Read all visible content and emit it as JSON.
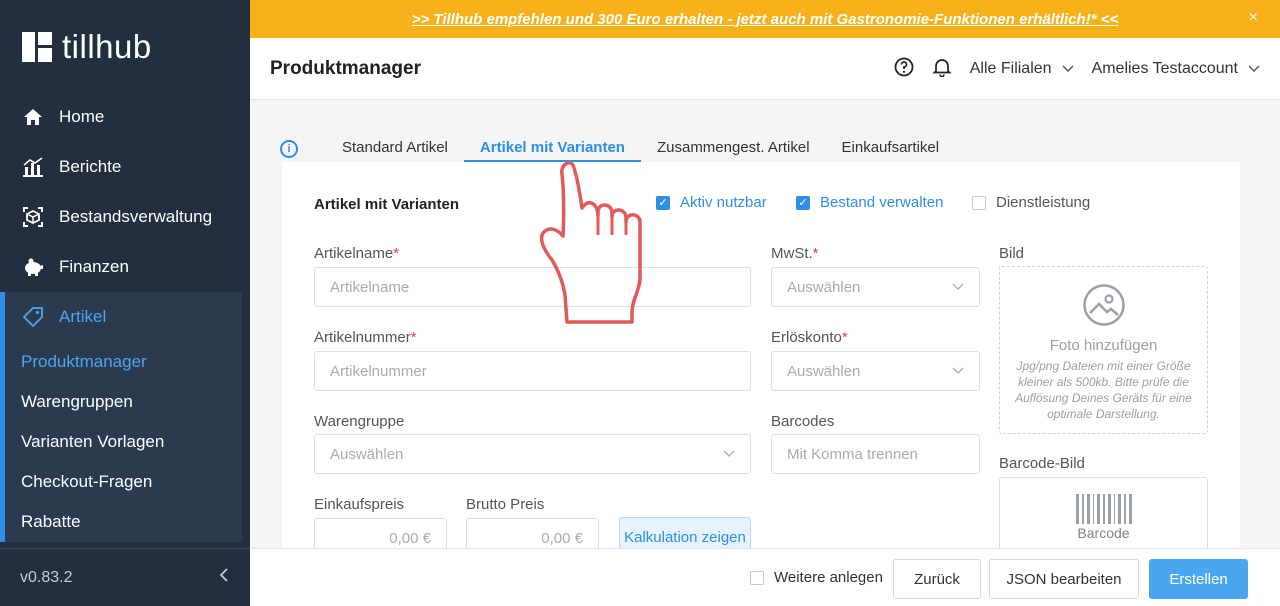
{
  "banner": {
    "text": ">> Tillhub empfehlen und 300 Euro erhalten - jetzt auch mit Gastronomie-Funktionen erhältlich!* <<",
    "close": "×"
  },
  "sidebar": {
    "logo": "tillhub",
    "items": [
      {
        "label": "Home",
        "icon": "home-icon"
      },
      {
        "label": "Berichte",
        "icon": "chart-icon"
      },
      {
        "label": "Bestandsverwaltung",
        "icon": "inventory-icon"
      },
      {
        "label": "Finanzen",
        "icon": "piggy-bank-icon"
      },
      {
        "label": "Artikel",
        "icon": "tag-icon"
      }
    ],
    "subitems": [
      "Produktmanager",
      "Warengruppen",
      "Varianten Vorlagen",
      "Checkout-Fragen",
      "Rabatte"
    ],
    "version": "v0.83.2"
  },
  "header": {
    "title": "Produktmanager",
    "branch": "Alle Filialen",
    "account": "Amelies Testaccount"
  },
  "tabs": [
    "Standard Artikel",
    "Artikel mit Varianten",
    "Zusammengest. Artikel",
    "Einkaufsartikel"
  ],
  "form": {
    "title": "Artikel mit Varianten",
    "checkboxes": [
      {
        "label": "Aktiv nutzbar",
        "checked": true
      },
      {
        "label": "Bestand verwalten",
        "checked": true
      },
      {
        "label": "Dienstleistung",
        "checked": false
      }
    ],
    "name_label": "Artikelname",
    "name_placeholder": "Artikelname",
    "number_label": "Artikelnummer",
    "number_placeholder": "Artikelnummer",
    "group_label": "Warengruppe",
    "group_placeholder": "Auswählen",
    "vat_label": "MwSt.",
    "vat_placeholder": "Auswählen",
    "revenue_label": "Erlöskonto",
    "revenue_placeholder": "Auswählen",
    "barcodes_label": "Barcodes",
    "barcodes_placeholder": "Mit Komma trennen",
    "purchase_label": "Einkaufspreis",
    "purchase_value": "0,00 €",
    "gross_label": "Brutto Preis",
    "gross_value": "0,00 €",
    "calc_button": "Kalkulation zeigen",
    "image_label": "Bild",
    "image_add": "Foto hinzufügen",
    "image_hint": "Jpg/png Dateien mit einer Größe kleiner als 500kb. Bitte prüfe die Auflösung Deines Geräts für eine optimale Darstellung.",
    "barcode_image_label": "Barcode-Bild",
    "barcode_text": "Barcode"
  },
  "footer": {
    "more": "Weitere anlegen",
    "back": "Zurück",
    "json": "JSON bearbeiten",
    "create": "Erstellen"
  },
  "colors": {
    "sidebar": "#232f3e",
    "accent": "#2f8fe4",
    "banner": "#f7b21b"
  }
}
